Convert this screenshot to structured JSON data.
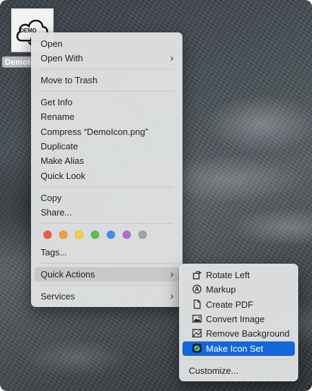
{
  "desktop": {
    "file": {
      "label": "DemoIcon.png",
      "thumb_text": "DEMO"
    }
  },
  "context_menu": {
    "items": [
      {
        "label": "Open"
      },
      {
        "label": "Open With",
        "submenu": true
      },
      {
        "label": "Move to Trash"
      },
      {
        "label": "Get Info"
      },
      {
        "label": "Rename"
      },
      {
        "label": "Compress “DemoIcon.png”"
      },
      {
        "label": "Duplicate"
      },
      {
        "label": "Make Alias"
      },
      {
        "label": "Quick Look"
      },
      {
        "label": "Copy"
      },
      {
        "label": "Share..."
      },
      {
        "label": "Tags..."
      },
      {
        "label": "Quick Actions",
        "submenu": true,
        "highlighted": true
      },
      {
        "label": "Services",
        "submenu": true
      }
    ],
    "tag_colors": [
      {
        "name": "red",
        "color": "#f0574d"
      },
      {
        "name": "orange",
        "color": "#f5a033"
      },
      {
        "name": "yellow",
        "color": "#f7cf3a"
      },
      {
        "name": "green",
        "color": "#5ac150"
      },
      {
        "name": "blue",
        "color": "#3d8ff5"
      },
      {
        "name": "purple",
        "color": "#b36ad9"
      },
      {
        "name": "gray",
        "color": "#a3a3a6"
      }
    ],
    "chevron": "›"
  },
  "quick_actions_menu": {
    "items": [
      {
        "label": "Rotate Left",
        "icon": "rotate-left-icon"
      },
      {
        "label": "Markup",
        "icon": "markup-icon"
      },
      {
        "label": "Create PDF",
        "icon": "document-icon"
      },
      {
        "label": "Convert Image",
        "icon": "image-icon"
      },
      {
        "label": "Remove Background",
        "icon": "remove-background-icon"
      },
      {
        "label": "Make Icon Set",
        "icon": "app-icon",
        "selected": true
      },
      {
        "label": "Customize..."
      }
    ]
  },
  "colors": {
    "selection": "#1566d6",
    "hover": "#c6c8ca",
    "menu_background": "#dee0e1"
  }
}
